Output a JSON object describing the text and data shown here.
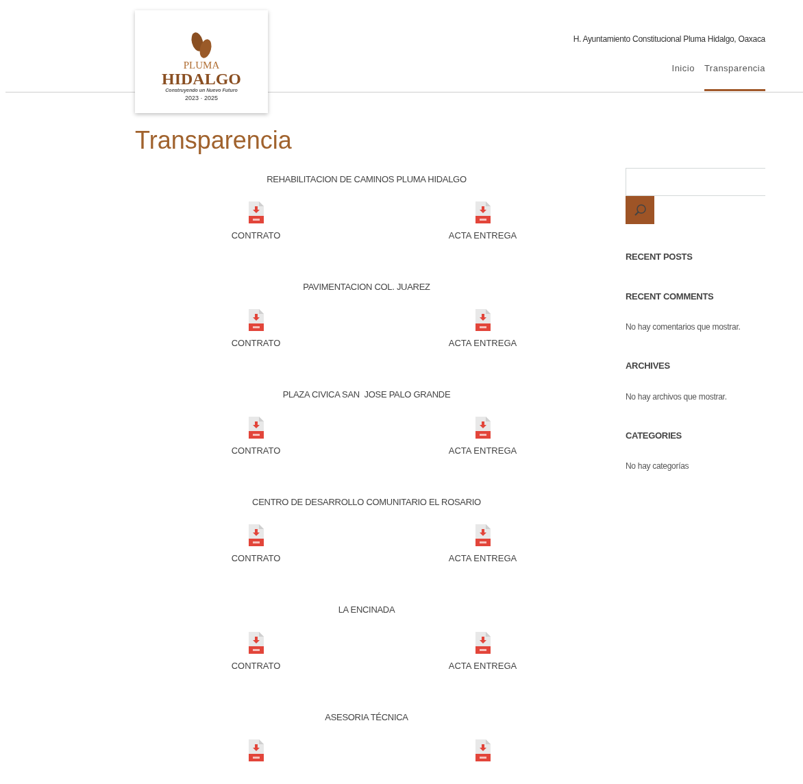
{
  "logo": {
    "line1": "PLUMA",
    "line2": "HIDALGO",
    "tagline": "Construyendo un Nuevo Futuro",
    "years": "2023 · 2025"
  },
  "header": {
    "site_title": "H. Ayuntamiento Constitucional Pluma Hidalgo, Oaxaca"
  },
  "nav": [
    {
      "label": "Inicio",
      "selected": false
    },
    {
      "label": "Transparencia",
      "selected": true
    }
  ],
  "page_title": "Transparencia",
  "projects": [
    {
      "title": "REHABILITACION DE CAMINOS PLUMA HIDALGO",
      "documents": [
        {
          "kind": "pdf",
          "label": "CONTRATO"
        },
        {
          "kind": "pdf",
          "label": "ACTA ENTREGA"
        }
      ]
    },
    {
      "title": "PAVIMENTACION COL. JUAREZ",
      "documents": [
        {
          "kind": "pdf",
          "label": "CONTRATO"
        },
        {
          "kind": "pdf",
          "label": "ACTA ENTREGA"
        }
      ]
    },
    {
      "title": "PLAZA CIVICA SAN  JOSE PALO GRANDE",
      "documents": [
        {
          "kind": "pdf",
          "label": "CONTRATO"
        },
        {
          "kind": "pdf",
          "label": "ACTA ENTREGA"
        }
      ]
    },
    {
      "title": "CENTRO DE DESARROLLO COMUNITARIO EL ROSARIO",
      "documents": [
        {
          "kind": "pdf",
          "label": "CONTRATO"
        },
        {
          "kind": "pdf",
          "label": "ACTA ENTREGA"
        }
      ]
    },
    {
      "title": "LA ENCINADA",
      "documents": [
        {
          "kind": "pdf",
          "label": "CONTRATO"
        },
        {
          "kind": "pdf",
          "label": "ACTA ENTREGA"
        }
      ]
    },
    {
      "title": "ASESORIA TÉCNICA",
      "documents": [
        {
          "kind": "pdf"
        },
        {
          "kind": "pdf"
        }
      ]
    }
  ],
  "sidebar": {
    "widgets": [
      {
        "heading": "RECENT POSTS"
      },
      {
        "heading": "RECENT COMMENTS",
        "text": "No hay comentarios que mostrar."
      },
      {
        "heading": "ARCHIVES",
        "text": "No hay archivos que mostrar."
      },
      {
        "heading": "CATEGORIES",
        "text": "No hay categorías"
      }
    ]
  }
}
